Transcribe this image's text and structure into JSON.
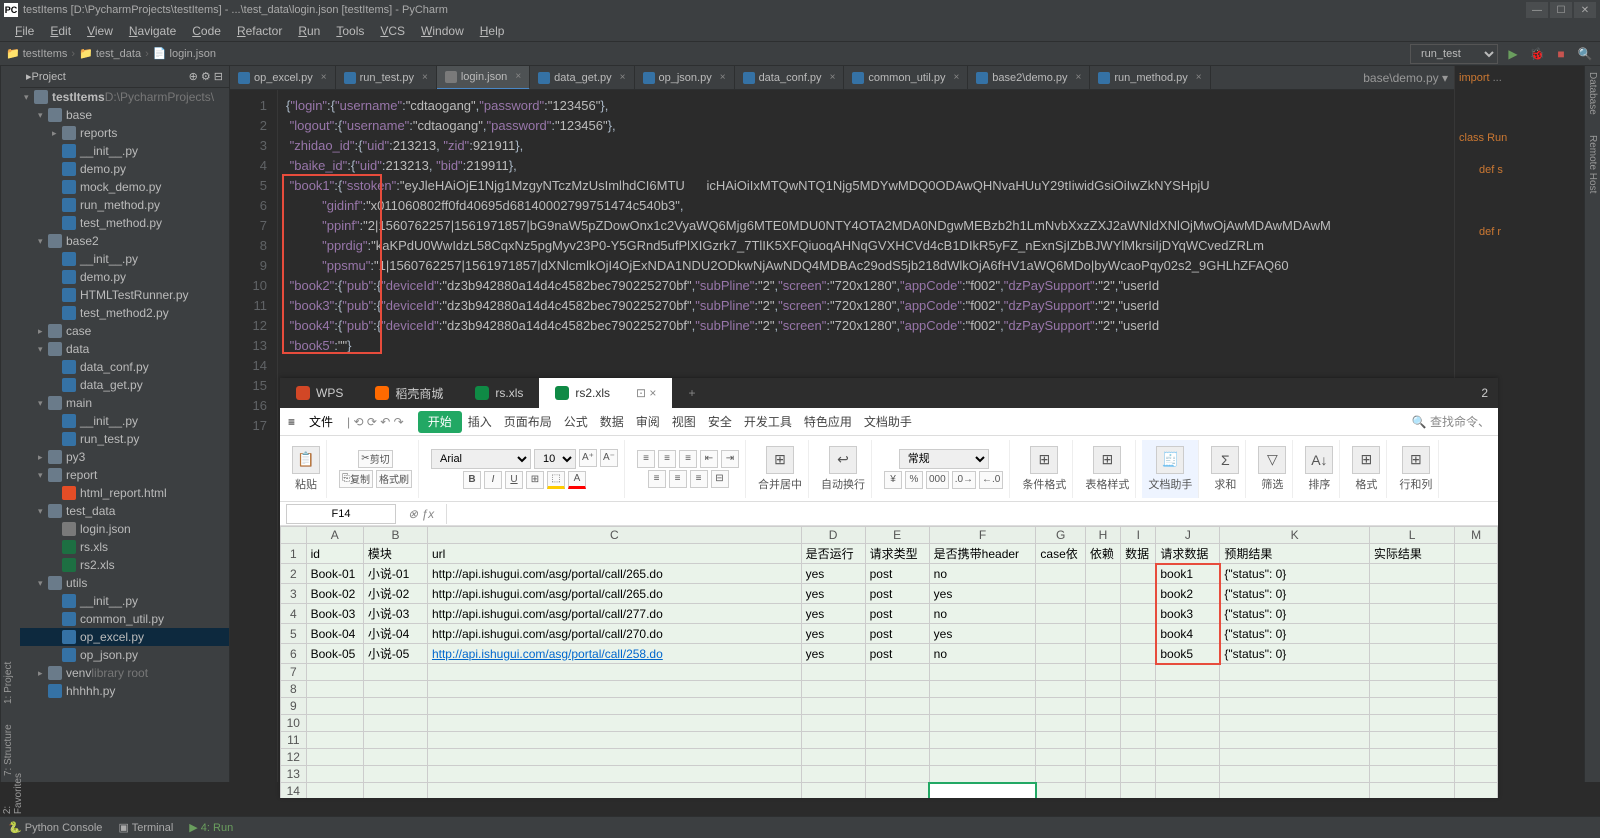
{
  "window": {
    "title": "testItems [D:\\PycharmProjects\\testItems] - ...\\test_data\\login.json [testItems] - PyCharm"
  },
  "menu": [
    "File",
    "Edit",
    "View",
    "Navigate",
    "Code",
    "Refactor",
    "Run",
    "Tools",
    "VCS",
    "Window",
    "Help"
  ],
  "menu_underlines": [
    "F",
    "E",
    "V",
    "N",
    "C",
    "R",
    "R",
    "T",
    "V",
    "W",
    "H"
  ],
  "breadcrumb": [
    "testItems",
    "test_data",
    "login.json"
  ],
  "run_config": "run_test",
  "project_header": "Project",
  "left_tools": [
    "1: Project",
    "7: Structure"
  ],
  "right_tools": [
    "Database",
    "Remote Host"
  ],
  "tree": [
    {
      "d": 0,
      "t": "testItems",
      "sub": "D:\\PycharmProjects\\",
      "ic": "fold",
      "tw": "▾",
      "bold": true
    },
    {
      "d": 1,
      "t": "base",
      "ic": "fold",
      "tw": "▾"
    },
    {
      "d": 2,
      "t": "reports",
      "ic": "fold",
      "tw": "▸"
    },
    {
      "d": 2,
      "t": "__init__.py",
      "ic": "py"
    },
    {
      "d": 2,
      "t": "demo.py",
      "ic": "py"
    },
    {
      "d": 2,
      "t": "mock_demo.py",
      "ic": "py"
    },
    {
      "d": 2,
      "t": "run_method.py",
      "ic": "py"
    },
    {
      "d": 2,
      "t": "test_method.py",
      "ic": "py"
    },
    {
      "d": 1,
      "t": "base2",
      "ic": "fold",
      "tw": "▾"
    },
    {
      "d": 2,
      "t": "__init__.py",
      "ic": "py"
    },
    {
      "d": 2,
      "t": "demo.py",
      "ic": "py"
    },
    {
      "d": 2,
      "t": "HTMLTestRunner.py",
      "ic": "py"
    },
    {
      "d": 2,
      "t": "test_method2.py",
      "ic": "py"
    },
    {
      "d": 1,
      "t": "case",
      "ic": "fold",
      "tw": "▸"
    },
    {
      "d": 1,
      "t": "data",
      "ic": "fold",
      "tw": "▾"
    },
    {
      "d": 2,
      "t": "data_conf.py",
      "ic": "py"
    },
    {
      "d": 2,
      "t": "data_get.py",
      "ic": "py"
    },
    {
      "d": 1,
      "t": "main",
      "ic": "fold",
      "tw": "▾"
    },
    {
      "d": 2,
      "t": "__init__.py",
      "ic": "py"
    },
    {
      "d": 2,
      "t": "run_test.py",
      "ic": "py"
    },
    {
      "d": 1,
      "t": "py3",
      "ic": "fold",
      "tw": "▸"
    },
    {
      "d": 1,
      "t": "report",
      "ic": "fold",
      "tw": "▾"
    },
    {
      "d": 2,
      "t": "html_report.html",
      "ic": "html"
    },
    {
      "d": 1,
      "t": "test_data",
      "ic": "fold",
      "tw": "▾"
    },
    {
      "d": 2,
      "t": "login.json",
      "ic": "json"
    },
    {
      "d": 2,
      "t": "rs.xls",
      "ic": "xls"
    },
    {
      "d": 2,
      "t": "rs2.xls",
      "ic": "xls"
    },
    {
      "d": 1,
      "t": "utils",
      "ic": "fold",
      "tw": "▾"
    },
    {
      "d": 2,
      "t": "__init__.py",
      "ic": "py"
    },
    {
      "d": 2,
      "t": "common_util.py",
      "ic": "py"
    },
    {
      "d": 2,
      "t": "op_excel.py",
      "ic": "py",
      "sel": true
    },
    {
      "d": 2,
      "t": "op_json.py",
      "ic": "py"
    },
    {
      "d": 1,
      "t": "venv",
      "sub": "library root",
      "ic": "fold",
      "tw": "▸"
    },
    {
      "d": 1,
      "t": "hhhhh.py",
      "ic": "py"
    }
  ],
  "editor_tabs": [
    {
      "l": "op_excel.py",
      "ic": "py"
    },
    {
      "l": "run_test.py",
      "ic": "py"
    },
    {
      "l": "login.json",
      "ic": "json",
      "active": true
    },
    {
      "l": "data_get.py",
      "ic": "py"
    },
    {
      "l": "op_json.py",
      "ic": "py"
    },
    {
      "l": "data_conf.py",
      "ic": "py"
    },
    {
      "l": "common_util.py",
      "ic": "py"
    },
    {
      "l": "base2\\demo.py",
      "ic": "py"
    },
    {
      "l": "run_method.py",
      "ic": "py"
    }
  ],
  "editor_more_tab": "base\\demo.py",
  "json_lines": [
    {
      "n": 1,
      "raw": "{\"login\":{\"username\":\"cdtaogang\",\"password\":\"123456\"},"
    },
    {
      "n": 2,
      "raw": " \"logout\":{\"username\":\"cdtaogang\",\"password\":\"123456\"},"
    },
    {
      "n": 3,
      "raw": " \"zhidao_id\":{\"uid\":213213, \"zid\":921911},"
    },
    {
      "n": 4,
      "raw": " \"baike_id\":{\"uid\":213213, \"bid\":219911},"
    },
    {
      "n": 5,
      "raw": " \"book1\":{\"sstoken\":\"eyJleHAiOjE1Njg1MzgyNTczMzUsImlhdCI6MTU      icHAiOiIxMTQwNTQ1Njg5MDYwMDQ0ODAwQHNvaHUuY29tIiwidGsiOiIwZkNYSHpjU"
    },
    {
      "n": 6,
      "raw": "          \"gidinf\":\"x011060802ff0fd40695d68140002799751474c540b3\","
    },
    {
      "n": 7,
      "raw": "          \"ppinf\":\"2|1560762257|1561971857|bG9naW5pZDowOnx1c2VyaWQ6Mjg6MTE0MDU0NTY4OTA2MDA0NDgwMEBzb2h1LmNvbXxzZXJ2aWNldXNlOjMwOjAwMDAwMDAwM"
    },
    {
      "n": 8,
      "raw": "          \"pprdig\":\"kaKPdU0WwIdzL58CqxNz5pgMyv23P0-Y5GRnd5ufPlXIGzrk7_7TlIK5XFQiuoqAHNqGVXHCVd4cB1DIkR5yFZ_nExnSjIZbBJWYlMkrsiIjDYqWCvedZRLm"
    },
    {
      "n": 9,
      "raw": "          \"ppsmu\":\"1|1560762257|1561971857|dXNlcmlkOjI4OjExNDA1NDU2ODkwNjAwNDQ4MDBAc29odS5jb218dWlkOjA6fHV1aWQ6MDo|byWcaoPqy02s2_9GHLhZFAQ60"
    },
    {
      "n": 10,
      "raw": " \"book2\":{\"pub\":{\"deviceId\":\"dz3b942880a14d4c4582bec790225270bf\",\"subPline\":\"2\",\"screen\":\"720x1280\",\"appCode\":\"f002\",\"dzPaySupport\":\"2\",\"userId"
    },
    {
      "n": 11,
      "raw": " \"book3\":{\"pub\":{\"deviceId\":\"dz3b942880a14d4c4582bec790225270bf\",\"subPline\":\"2\",\"screen\":\"720x1280\",\"appCode\":\"f002\",\"dzPaySupport\":\"2\",\"userId"
    },
    {
      "n": 12,
      "raw": " \"book4\":{\"pub\":{\"deviceId\":\"dz3b942880a14d4c4582bec790225270bf\",\"subPline\":\"2\",\"screen\":\"720x1280\",\"appCode\":\"f002\",\"dzPaySupport\":\"2\",\"userId"
    },
    {
      "n": 13,
      "raw": " \"book5\":\"\"}"
    },
    {
      "n": 14,
      "raw": ""
    },
    {
      "n": 15,
      "raw": ""
    },
    {
      "n": 16,
      "raw": ""
    },
    {
      "n": 17,
      "raw": ""
    }
  ],
  "right_panel": {
    "import": "import",
    "class": "class Run",
    "def1": "def s",
    "def2": "def r"
  },
  "wps": {
    "tabs": [
      {
        "l": "WPS",
        "ic": "w"
      },
      {
        "l": "稻壳商城",
        "ic": "d"
      },
      {
        "l": "rs.xls",
        "ic": "s"
      },
      {
        "l": "rs2.xls",
        "ic": "s",
        "active": true
      }
    ],
    "file_label": "文件",
    "ribbon_tabs": [
      "开始",
      "插入",
      "页面布局",
      "公式",
      "数据",
      "审阅",
      "视图",
      "安全",
      "开发工具",
      "特色应用",
      "文档助手"
    ],
    "search_placeholder": "查找命令、",
    "toolbar": {
      "paste": "粘贴",
      "cut": "剪切",
      "copy": "复制",
      "format_painter": "格式刷",
      "font": "Arial",
      "size": "10",
      "merge": "合并居中",
      "wrap": "自动换行",
      "number_format": "常规",
      "cond_format": "条件格式",
      "table_style": "表格样式",
      "doc_helper": "文档助手",
      "sum": "求和",
      "filter": "筛选",
      "sort": "排序",
      "format": "格式",
      "rowcol": "行和列"
    },
    "namebox": "F14",
    "cols": [
      "A",
      "B",
      "C",
      "D",
      "E",
      "F",
      "G",
      "H",
      "I",
      "J",
      "K",
      "L",
      "M"
    ],
    "header": [
      "id",
      "模块",
      "url",
      "是否运行",
      "请求类型",
      "是否携带header",
      "case依",
      "依赖",
      "数据",
      "请求数据",
      "预期结果",
      "实际结果"
    ],
    "rows": [
      {
        "n": 2,
        "c": [
          "Book-01",
          "小说-01",
          "http://api.ishugui.com/asg/portal/call/265.do",
          "yes",
          "post",
          "no",
          "",
          "",
          "",
          "book1",
          "{\"status\": 0}",
          ""
        ]
      },
      {
        "n": 3,
        "c": [
          "Book-02",
          "小说-02",
          "http://api.ishugui.com/asg/portal/call/265.do",
          "yes",
          "post",
          "yes",
          "",
          "",
          "",
          "book2",
          "{\"status\": 0}",
          ""
        ]
      },
      {
        "n": 4,
        "c": [
          "Book-03",
          "小说-03",
          "http://api.ishugui.com/asg/portal/call/277.do",
          "yes",
          "post",
          "no",
          "",
          "",
          "",
          "book3",
          "{\"status\": 0}",
          ""
        ]
      },
      {
        "n": 5,
        "c": [
          "Book-04",
          "小说-04",
          "http://api.ishugui.com/asg/portal/call/270.do",
          "yes",
          "post",
          "yes",
          "",
          "",
          "",
          "book4",
          "{\"status\": 0}",
          ""
        ]
      },
      {
        "n": 6,
        "c": [
          "Book-05",
          "小说-05",
          "http://api.ishugui.com/asg/portal/call/258.do",
          "yes",
          "post",
          "no",
          "",
          "",
          "",
          "book5",
          "{\"status\": 0}",
          ""
        ],
        "link": true
      }
    ],
    "empty_rows": [
      7,
      8,
      9,
      10,
      11,
      12,
      13,
      14
    ]
  },
  "bottom": {
    "console": "Python Console",
    "terminal": "Terminal",
    "run": "4: Run",
    "favorites": "2: Favorites"
  }
}
